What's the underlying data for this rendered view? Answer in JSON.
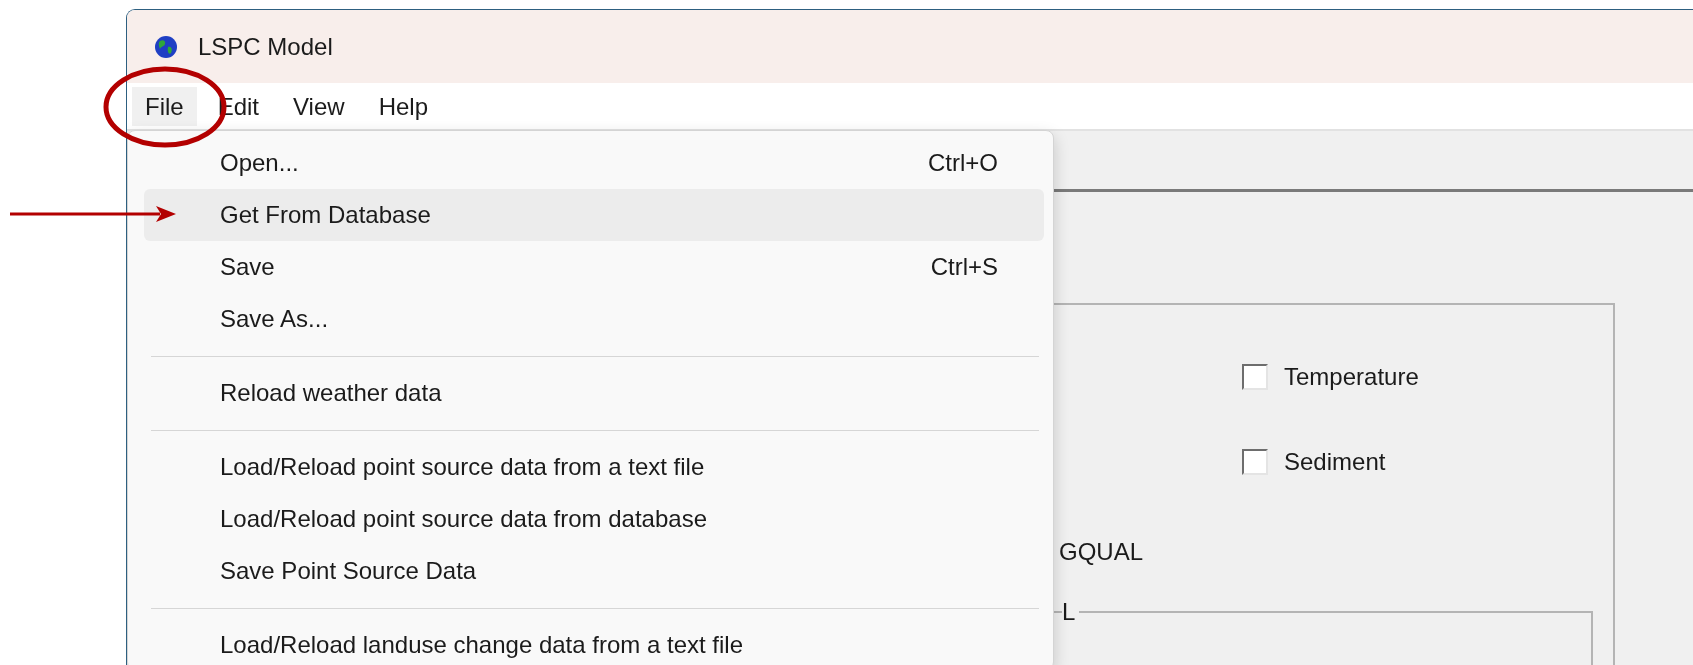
{
  "window": {
    "title": "LSPC Model"
  },
  "menu_bar": [
    {
      "label": "File",
      "selected": true
    },
    {
      "label": "Edit",
      "selected": false
    },
    {
      "label": "View",
      "selected": false
    },
    {
      "label": "Help",
      "selected": false
    }
  ],
  "file_menu": {
    "items": [
      {
        "kind": "item",
        "label": "Open...",
        "shortcut": "Ctrl+O",
        "selected": false
      },
      {
        "kind": "item",
        "label": "Get From Database",
        "selected": true
      },
      {
        "kind": "item",
        "label": "Save",
        "shortcut": "Ctrl+S",
        "selected": false
      },
      {
        "kind": "item",
        "label": "Save As...",
        "selected": false
      },
      {
        "kind": "separator"
      },
      {
        "kind": "item",
        "label": "Reload weather data",
        "selected": false
      },
      {
        "kind": "separator"
      },
      {
        "kind": "item",
        "label": "Load/Reload point source data from a text file",
        "selected": false
      },
      {
        "kind": "item",
        "label": "Load/Reload point source data from database",
        "selected": false
      },
      {
        "kind": "item",
        "label": "Save Point Source Data",
        "selected": false
      },
      {
        "kind": "separator"
      },
      {
        "kind": "item",
        "label": "Load/Reload landuse change data from a text file",
        "selected": false
      }
    ]
  },
  "panel": {
    "checkboxes": [
      {
        "label": "Temperature",
        "checked": false
      },
      {
        "label": "Sediment",
        "checked": false
      }
    ],
    "field_label": "GQUAL",
    "group_label": "L"
  }
}
